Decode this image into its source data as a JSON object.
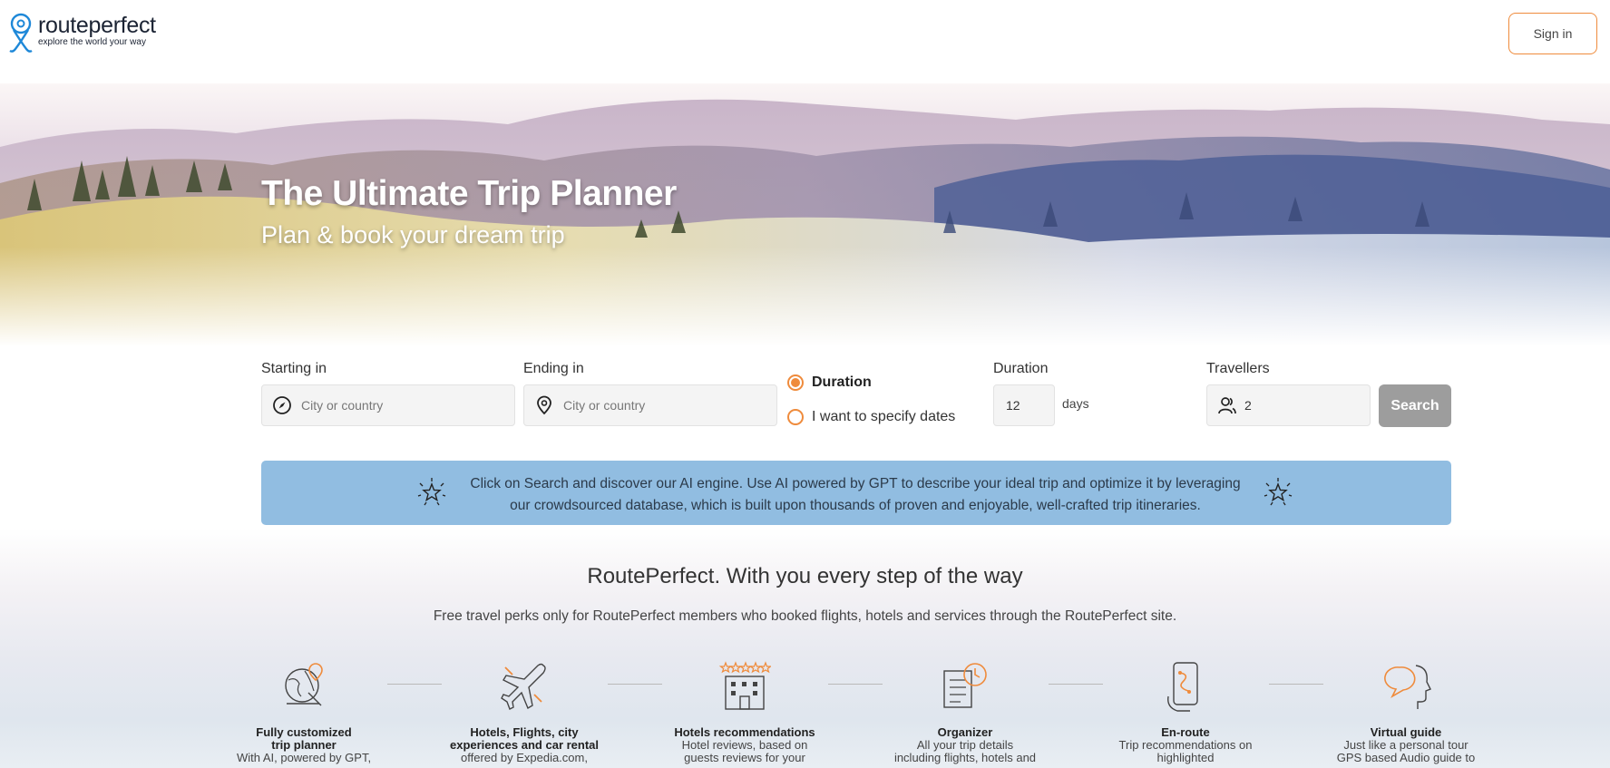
{
  "header": {
    "logo_name": "routeperfect",
    "logo_tagline": "explore the world your way",
    "signin_label": "Sign in"
  },
  "hero": {
    "title": "The Ultimate Trip Planner",
    "subtitle": "Plan & book your dream trip"
  },
  "search": {
    "start_label": "Starting in",
    "start_placeholder": "City or country",
    "end_label": "Ending in",
    "end_placeholder": "City or country",
    "radio_duration": "Duration",
    "radio_dates": "I want to specify dates",
    "duration_label": "Duration",
    "duration_value": "12",
    "duration_unit": "days",
    "travellers_label": "Travellers",
    "travellers_value": "2",
    "search_label": "Search"
  },
  "banner": {
    "line1": "Click on Search and discover our AI engine. Use AI powered by GPT to describe your ideal trip and optimize it by leveraging",
    "line2": "our crowdsourced database, which is built upon thousands of proven and enjoyable, well-crafted trip itineraries."
  },
  "features_section": {
    "title": "RoutePerfect. With you every step of the way",
    "subtitle": "Free travel perks only for RoutePerfect members who booked flights, hotels and services through the RoutePerfect site."
  },
  "features": [
    {
      "icon": "globe-pin-icon",
      "title_lines": [
        "Fully customized",
        "trip planner"
      ],
      "desc": "With AI, powered by GPT,"
    },
    {
      "icon": "airplane-icon",
      "title_lines": [
        "Hotels, Flights, city",
        "experiences and car rental"
      ],
      "desc": "offered by Expedia.com,"
    },
    {
      "icon": "hotel-stars-icon",
      "title_lines": [
        "Hotels recommendations"
      ],
      "desc_lines": [
        "Hotel reviews, based on",
        "guests reviews for your"
      ]
    },
    {
      "icon": "organizer-icon",
      "title_lines": [
        "Organizer"
      ],
      "desc_lines": [
        "All your trip details",
        "including flights, hotels and"
      ]
    },
    {
      "icon": "phone-route-icon",
      "title_lines": [
        "En-route"
      ],
      "desc_lines": [
        "Trip recommendations on",
        "highlighted"
      ]
    },
    {
      "icon": "audio-guide-icon",
      "title_lines": [
        "Virtual guide"
      ],
      "desc_lines": [
        "Just like a personal tour",
        "GPS based Audio guide to"
      ]
    }
  ],
  "colors": {
    "accent": "#ef8b3c",
    "banner": "#91bde1",
    "search_button": "#9d9d9d"
  }
}
